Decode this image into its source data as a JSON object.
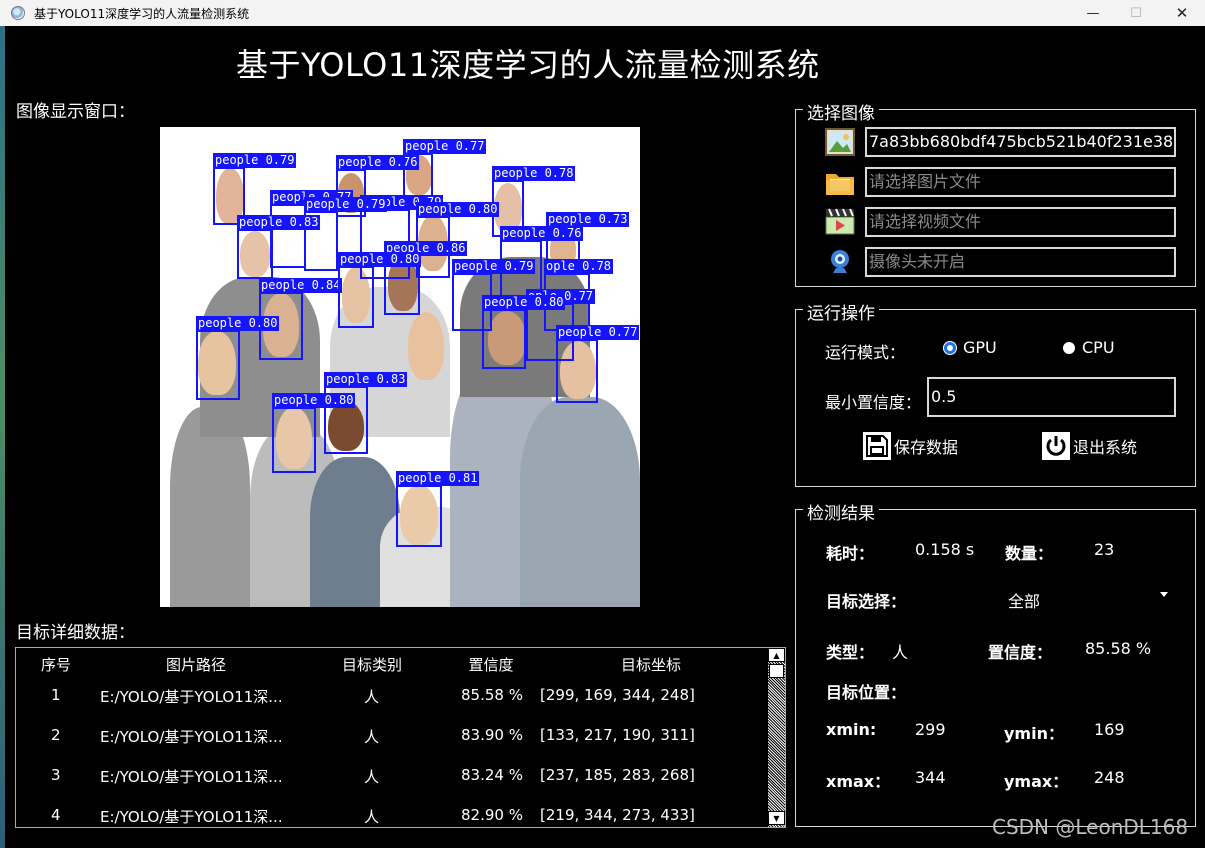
{
  "window": {
    "title": "基于YOLO11深度学习的人流量检测系统",
    "controls": [
      "—",
      "☐",
      "✕"
    ]
  },
  "main_title": "基于YOLO11深度学习的人流量检测系统",
  "image_label": "图像显示窗口：",
  "detections": [
    {
      "label": "people 0.79"
    },
    {
      "label": "people 0.76"
    },
    {
      "label": "people 0.77"
    },
    {
      "label": "people 0.78"
    },
    {
      "label": "people 0.77"
    },
    {
      "label": "people 0.79"
    },
    {
      "label": "people 0.80"
    },
    {
      "label": "people 0.79"
    },
    {
      "label": "people 0.73"
    },
    {
      "label": "people 0.76"
    },
    {
      "label": "people 0.86"
    },
    {
      "label": "people 0.83"
    },
    {
      "label": "people 0.79"
    },
    {
      "label": "ople 0.78"
    },
    {
      "label": "people 0.84"
    },
    {
      "label": "people 0.80"
    },
    {
      "label": "ople 0.77"
    },
    {
      "label": "people 0.80"
    },
    {
      "label": "people 0.77"
    },
    {
      "label": "people 0.83"
    },
    {
      "label": "people 0.80"
    },
    {
      "label": "people 0.81"
    }
  ],
  "table": {
    "label": "目标详细数据：",
    "headers": [
      "序号",
      "图片路径",
      "目标类别",
      "置信度",
      "目标坐标"
    ],
    "rows": [
      {
        "idx": "1",
        "path": "E:/YOLO/基于YOLO11深...",
        "cls": "人",
        "conf": "85.58 %",
        "coords": "[299, 169, 344, 248]"
      },
      {
        "idx": "2",
        "path": "E:/YOLO/基于YOLO11深...",
        "cls": "人",
        "conf": "83.90 %",
        "coords": "[133, 217, 190, 311]"
      },
      {
        "idx": "3",
        "path": "E:/YOLO/基于YOLO11深...",
        "cls": "人",
        "conf": "83.24 %",
        "coords": "[237, 185, 283, 268]"
      },
      {
        "idx": "4",
        "path": "E:/YOLO/基于YOLO11深...",
        "cls": "人",
        "conf": "82.90 %",
        "coords": "[219, 344, 273, 433]"
      }
    ]
  },
  "select_group": {
    "title": "选择图像",
    "image_file": "7a83bb680bdf475bcb521b40f231e38.jpg",
    "folder_placeholder": "请选择图片文件",
    "video_placeholder": "请选择视频文件",
    "camera_placeholder": "摄像头未开启"
  },
  "run_group": {
    "title": "运行操作",
    "mode_label": "运行模式：",
    "mode_options": [
      "GPU",
      "CPU"
    ],
    "selected_mode": "GPU",
    "conf_label": "最小置信度：",
    "conf_value": "0.5",
    "save_button": "保存数据",
    "exit_button": "退出系统"
  },
  "result_group": {
    "title": "检测结果",
    "time_label": "耗时：",
    "time_value": "0.158 s",
    "count_label": "数量：",
    "count_value": "23",
    "target_label": "目标选择：",
    "target_value": "全部",
    "type_label": "类型：",
    "type_value": "人",
    "conf_label": "置信度：",
    "conf_value": "85.58 %",
    "pos_label": "目标位置：",
    "xmin_label": "xmin:",
    "xmin_value": "299",
    "ymin_label": "ymin：",
    "ymin_value": "169",
    "xmax_label": "xmax：",
    "xmax_value": "344",
    "ymax_label": "ymax：",
    "ymax_value": "248"
  },
  "watermark": "CSDN @LeonDL168",
  "colors": {
    "accent": "#1a73e8",
    "box": "#1414ff",
    "background": "#000000"
  }
}
